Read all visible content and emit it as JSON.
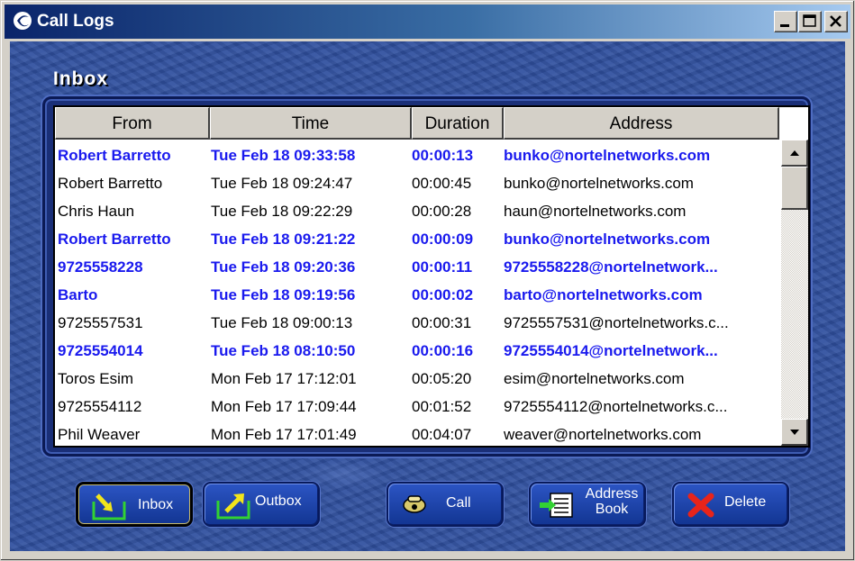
{
  "window": {
    "title": "Call Logs"
  },
  "section": {
    "title": "Inbox"
  },
  "table": {
    "columns": [
      "From",
      "Time",
      "Duration",
      "Address"
    ],
    "rows": [
      {
        "from": "Robert Barretto",
        "time": "Tue Feb 18 09:33:58",
        "duration": "00:00:13",
        "address": "bunko@nortelnetworks.com",
        "unread": true
      },
      {
        "from": "Robert Barretto",
        "time": "Tue Feb 18 09:24:47",
        "duration": "00:00:45",
        "address": "bunko@nortelnetworks.com",
        "unread": false
      },
      {
        "from": "Chris Haun",
        "time": "Tue Feb 18 09:22:29",
        "duration": "00:00:28",
        "address": "haun@nortelnetworks.com",
        "unread": false
      },
      {
        "from": "Robert Barretto",
        "time": "Tue Feb 18 09:21:22",
        "duration": "00:00:09",
        "address": "bunko@nortelnetworks.com",
        "unread": true
      },
      {
        "from": "9725558228",
        "time": "Tue Feb 18 09:20:36",
        "duration": "00:00:11",
        "address": "9725558228@nortelnetwork...",
        "unread": true
      },
      {
        "from": "Barto",
        "time": "Tue Feb 18 09:19:56",
        "duration": "00:00:02",
        "address": "barto@nortelnetworks.com",
        "unread": true
      },
      {
        "from": "9725557531",
        "time": "Tue Feb 18 09:00:13",
        "duration": "00:00:31",
        "address": "9725557531@nortelnetworks.c...",
        "unread": false
      },
      {
        "from": "9725554014",
        "time": "Tue Feb 18 08:10:50",
        "duration": "00:00:16",
        "address": "9725554014@nortelnetwork...",
        "unread": true
      },
      {
        "from": "Toros Esim",
        "time": "Mon Feb 17 17:12:01",
        "duration": "00:05:20",
        "address": "esim@nortelnetworks.com",
        "unread": false
      },
      {
        "from": "9725554112",
        "time": "Mon Feb 17 17:09:44",
        "duration": "00:01:52",
        "address": "9725554112@nortelnetworks.c...",
        "unread": false
      },
      {
        "from": "Phil Weaver",
        "time": "Mon Feb 17 17:01:49",
        "duration": "00:04:07",
        "address": "weaver@nortelnetworks.com",
        "unread": false
      }
    ]
  },
  "toolbar": {
    "inbox_label": "Inbox",
    "outbox_label": "Outbox",
    "call_label": "Call",
    "address_book_line1": "Address",
    "address_book_line2": "Book",
    "delete_label": "Delete"
  },
  "colors": {
    "unread_text": "#1a1aee",
    "panel_blue": "#2f4f9e",
    "title_bar_start": "#0a246a"
  },
  "icons": [
    "app-logo-icon",
    "minimize-icon",
    "maximize-icon",
    "close-icon",
    "inbox-arrow-icon",
    "outbox-arrow-icon",
    "phone-icon",
    "address-book-icon",
    "delete-x-icon",
    "scroll-up-icon",
    "scroll-down-icon"
  ]
}
